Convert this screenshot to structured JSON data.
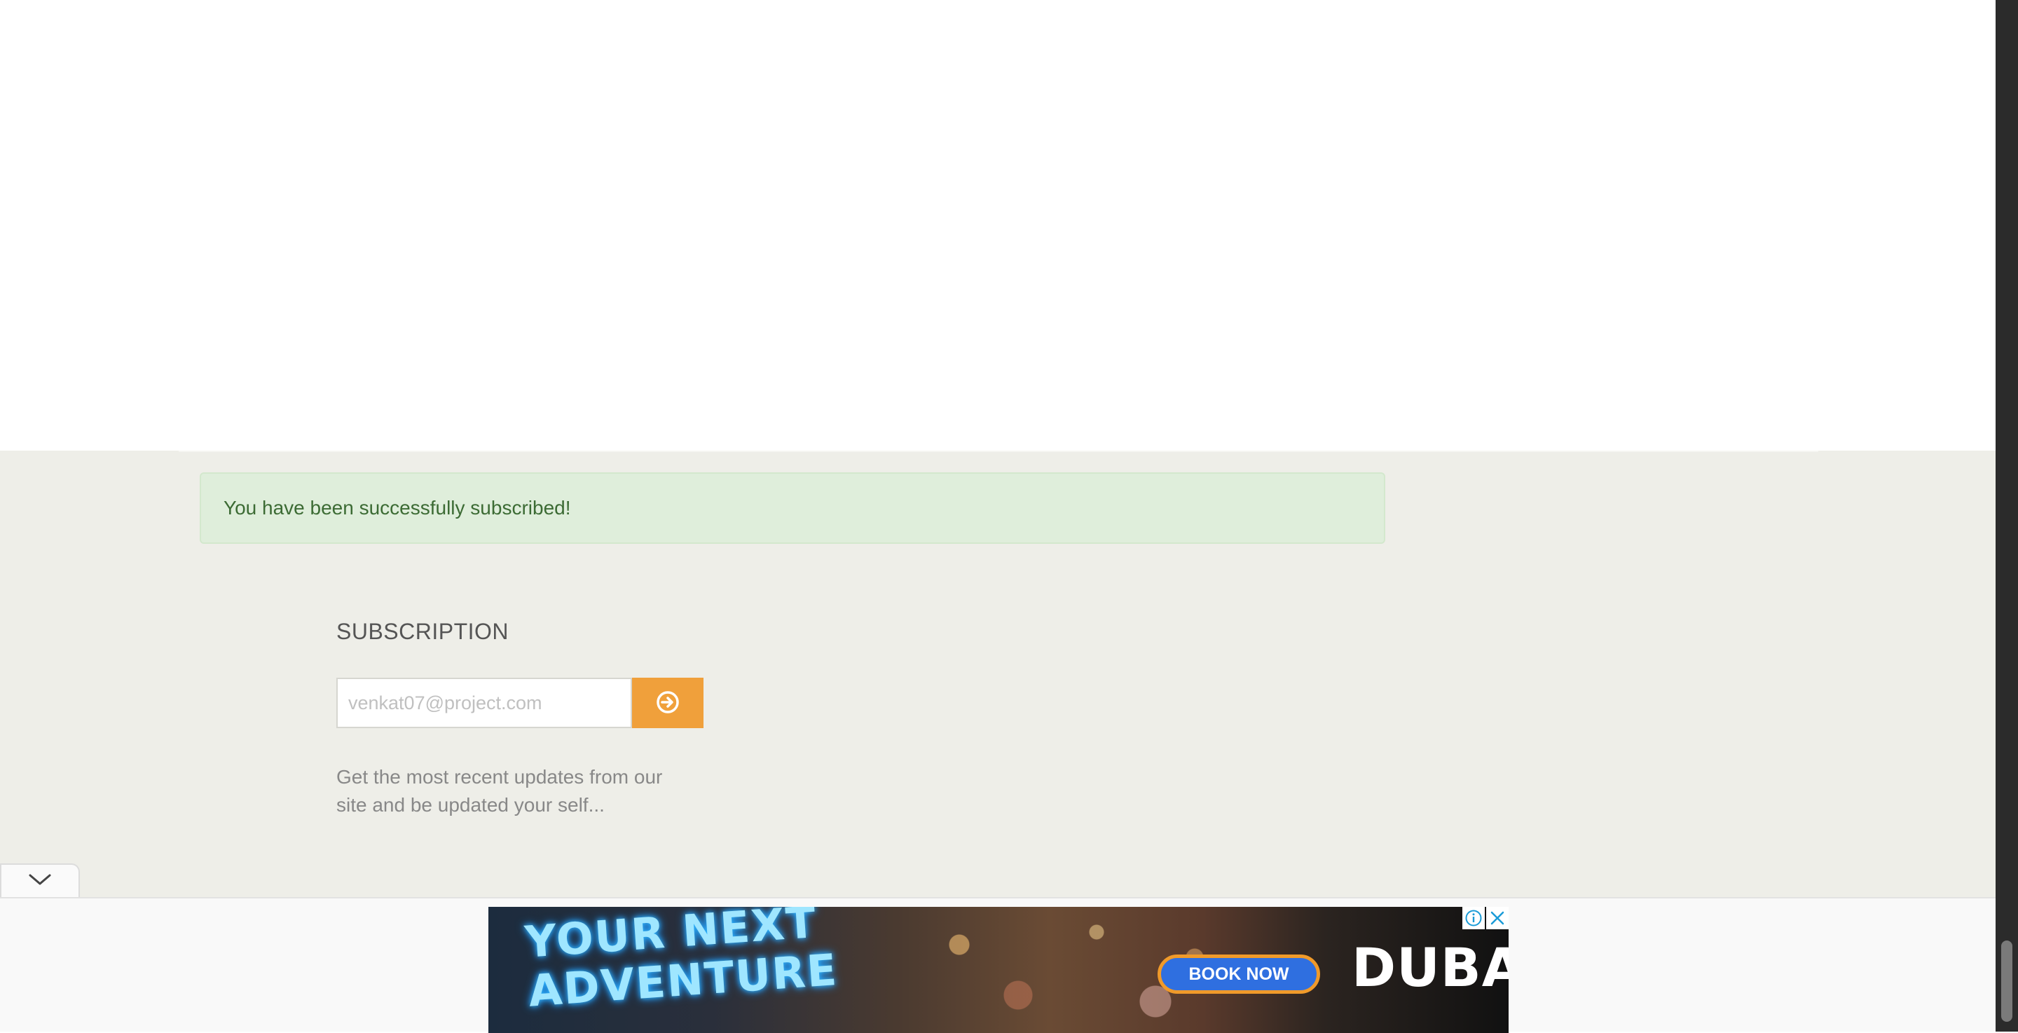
{
  "alert": {
    "message": "You have been successfully subscribed!"
  },
  "subscription": {
    "title": "SUBSCRIPTION",
    "email_placeholder": "venkat07@project.com",
    "submit_icon": "arrow-circle-right-icon",
    "description": "Get the most recent updates from our site and be updated your self..."
  },
  "collapse": {
    "icon": "chevron-down-icon"
  },
  "ad": {
    "headline": "YOUR NEXT ADVENTURE",
    "cta_label": "BOOK NOW",
    "brand": "DUBAI",
    "info_icon": "info-icon",
    "close_icon": "close-icon"
  },
  "colors": {
    "footer_bg": "#eeeee8",
    "alert_bg": "#dfeedb",
    "alert_text": "#3c6b34",
    "accent": "#f0a03b"
  }
}
